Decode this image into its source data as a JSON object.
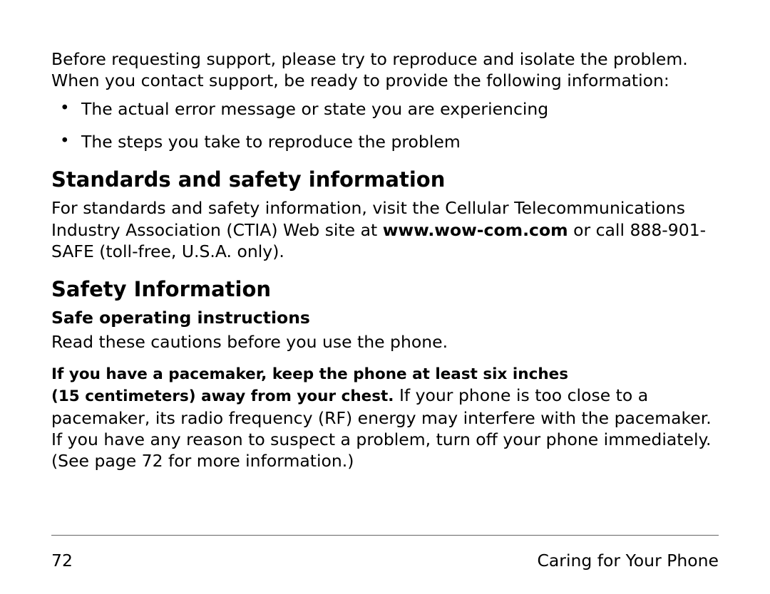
{
  "intro": "Before requesting support, please try to reproduce and isolate the problem. When you contact support, be ready to provide the following information:",
  "bullets": [
    "The actual error message or state you are experiencing",
    "The steps you take to reproduce the problem"
  ],
  "standards": {
    "heading": "Standards and safety information",
    "body_pre": "For standards and safety information, visit the Cellular Telecommunications Industry Association (CTIA) Web site at ",
    "url_bold": "www.wow-com.com",
    "body_post": " or call 888-901-SAFE (toll-free, U.S.A. only)."
  },
  "safety": {
    "heading": "Safety Information",
    "subhead": "Safe operating instructions",
    "lead_para": "Read these cautions before you use the phone.",
    "pacemaker_bold_1": "If you have a pacemaker, keep the phone at least six inches ",
    "pacemaker_bold_2": "(15 centimeters) away from your chest. ",
    "pacemaker_rest": "If your phone is too close to a pacemaker, its radio frequency (RF) energy may interfere with the pacemaker. If you have any reason to suspect a problem, turn off your phone immediately. (See page 72 for more information.)"
  },
  "footer": {
    "page_number": "72",
    "section_title": "Caring for Your Phone"
  }
}
